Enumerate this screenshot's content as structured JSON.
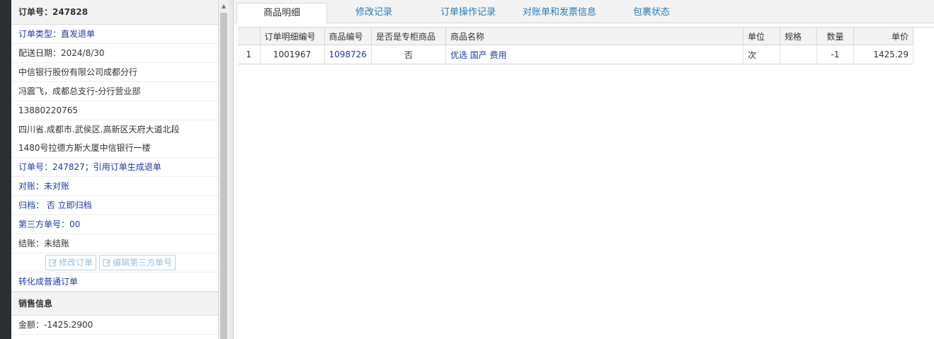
{
  "order_panel": {
    "order_no": "订单号：247828",
    "order_type": "订单类型：直发退单",
    "delivery_date": "配送日期：2024/8/30",
    "company": "中信银行股份有限公司成都分行",
    "contact": "冯震飞，成都总支行-分行营业部",
    "phone": "13880220765",
    "address_line1": "四川省.成都市.武侯区.高新区天府大道北段",
    "address_line2": "1480号拉德方斯大厦中信银行一楼",
    "ref_order": "订单号：247827；引用订单生成退单",
    "reconcile": "对账：未对账",
    "archive": "归档： 否 立即归档",
    "third_party": "第三方单号：00",
    "settle": "结账：未结账",
    "edit_order_label": "修改订单",
    "edit_third_party_label": "编辑第三方单号",
    "convert_label": "转化成普通订单"
  },
  "sales_info": {
    "title": "销售信息",
    "amount": "金额：-1425.2900"
  },
  "tabs": [
    {
      "label": "商品明细"
    },
    {
      "label": "修改记录"
    },
    {
      "label": "订单操作记录"
    },
    {
      "label": "对账单和发票信息"
    },
    {
      "label": "包裹状态"
    }
  ],
  "grid": {
    "headers": [
      "",
      "订单明细编号",
      "商品编号",
      "是否是专柜商品",
      "商品名称",
      "单位",
      "规格",
      "数量",
      "单价"
    ],
    "rows": [
      {
        "row_no": "1",
        "detail_no": "1001967",
        "product_no": "1098726",
        "is_counter": "否",
        "name": "优选 国产 费用",
        "unit": "次",
        "spec": "",
        "qty": "-1",
        "price": "1425.29"
      }
    ]
  },
  "colors": {
    "link_blue": "#1f3aa8",
    "tab_blue": "#2b7bb9",
    "button_border": "#b9d3ea"
  }
}
